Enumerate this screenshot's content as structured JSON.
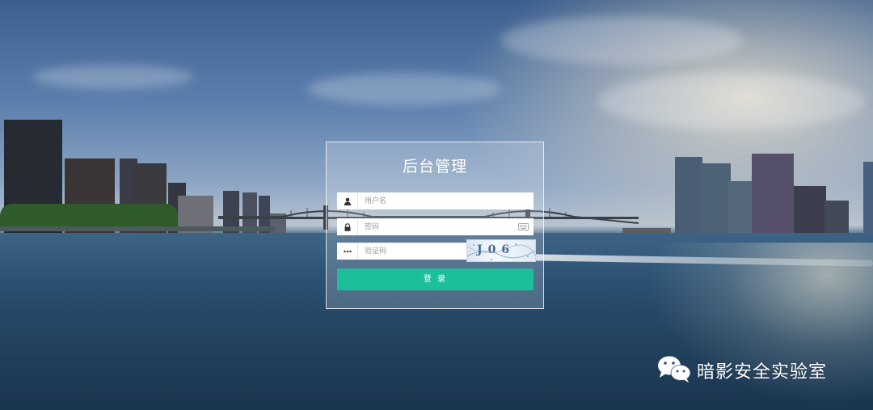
{
  "login": {
    "title": "后台管理",
    "username_placeholder": "用户名",
    "password_placeholder": "密码",
    "captcha_placeholder": "验证码",
    "captcha_text": "J06",
    "submit_label": "登 录"
  },
  "watermark": {
    "text": "暗影安全实验室",
    "icon": "wechat-icon"
  },
  "colors": {
    "accent": "#1cbf99",
    "panel_border": "#ffffff"
  }
}
